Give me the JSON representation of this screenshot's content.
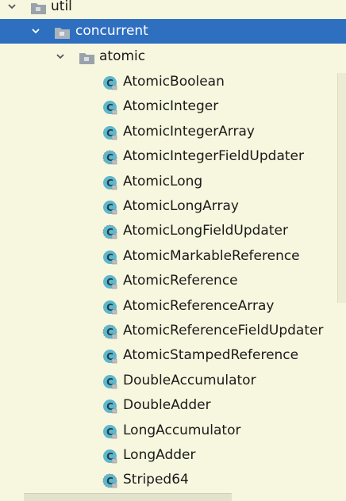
{
  "tree": {
    "util": {
      "label": "util"
    },
    "concurrent": {
      "label": "concurrent"
    },
    "atomic": {
      "label": "atomic"
    },
    "classes": [
      {
        "label": "AtomicBoolean",
        "icon": "class-icon"
      },
      {
        "label": "AtomicInteger",
        "icon": "class-icon"
      },
      {
        "label": "AtomicIntegerArray",
        "icon": "class-icon"
      },
      {
        "label": "AtomicIntegerFieldUpdater",
        "icon": "abstract-class-icon"
      },
      {
        "label": "AtomicLong",
        "icon": "class-icon"
      },
      {
        "label": "AtomicLongArray",
        "icon": "class-icon"
      },
      {
        "label": "AtomicLongFieldUpdater",
        "icon": "abstract-class-icon"
      },
      {
        "label": "AtomicMarkableReference",
        "icon": "class-icon"
      },
      {
        "label": "AtomicReference",
        "icon": "class-icon"
      },
      {
        "label": "AtomicReferenceArray",
        "icon": "class-icon"
      },
      {
        "label": "AtomicReferenceFieldUpdater",
        "icon": "abstract-class-icon"
      },
      {
        "label": "AtomicStampedReference",
        "icon": "class-icon"
      },
      {
        "label": "DoubleAccumulator",
        "icon": "class-icon"
      },
      {
        "label": "DoubleAdder",
        "icon": "class-icon"
      },
      {
        "label": "LongAccumulator",
        "icon": "class-icon"
      },
      {
        "label": "LongAdder",
        "icon": "class-icon"
      },
      {
        "label": "Striped64",
        "icon": "abstract-class-icon"
      }
    ]
  },
  "colors": {
    "background": "#f7f7df",
    "selection": "#2f6fc0",
    "class_icon": "#5fb7cc",
    "class_letter": "#1d3f4d"
  }
}
